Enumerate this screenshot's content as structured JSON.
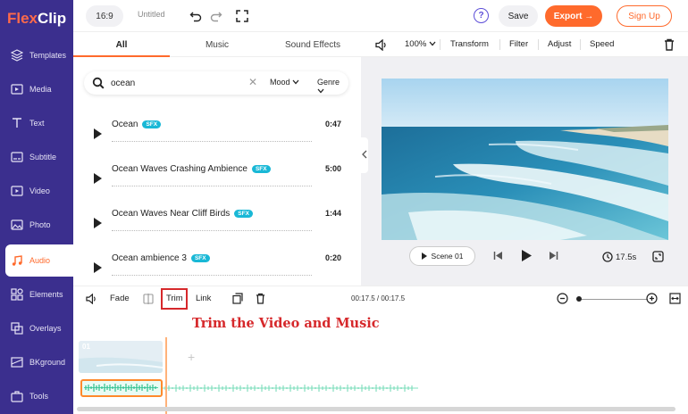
{
  "brand": {
    "name_part1": "Flex",
    "name_part2": "Clip"
  },
  "sidebar": {
    "items": [
      {
        "label": "Templates",
        "icon": "layers-icon"
      },
      {
        "label": "Media",
        "icon": "media-icon"
      },
      {
        "label": "Text",
        "icon": "text-icon"
      },
      {
        "label": "Subtitle",
        "icon": "subtitle-icon"
      },
      {
        "label": "Video",
        "icon": "video-icon"
      },
      {
        "label": "Photo",
        "icon": "photo-icon"
      },
      {
        "label": "Audio",
        "icon": "music-icon",
        "active": true
      },
      {
        "label": "Elements",
        "icon": "elements-icon"
      },
      {
        "label": "Overlays",
        "icon": "overlays-icon"
      },
      {
        "label": "BKground",
        "icon": "background-icon"
      },
      {
        "label": "Tools",
        "icon": "tools-icon"
      }
    ]
  },
  "topbar": {
    "ratio": "16:9",
    "doc_title": "Untitled",
    "help": "?",
    "save": "Save",
    "export": "Export →",
    "signup": "Sign Up"
  },
  "panel": {
    "tabs": [
      "All",
      "Music",
      "Sound Effects"
    ],
    "search": {
      "value": "ocean",
      "clear": "✕",
      "mood": "Mood",
      "genre": "Genre"
    },
    "tracks": [
      {
        "name": "Ocean",
        "badge": "SFX",
        "duration": "0:47"
      },
      {
        "name": "Ocean Waves Crashing Ambience",
        "badge": "SFX",
        "duration": "5:00"
      },
      {
        "name": "Ocean Waves Near Cliff Birds",
        "badge": "SFX",
        "duration": "1:44"
      },
      {
        "name": "Ocean ambience 3",
        "badge": "SFX",
        "duration": "0:20"
      }
    ]
  },
  "preview": {
    "toolbar": {
      "zoom": "100%",
      "transform": "Transform",
      "filter": "Filter",
      "adjust": "Adjust",
      "speed": "Speed"
    },
    "scene_label": "Scene 01",
    "duration": "17.5s"
  },
  "timeline": {
    "fade": "Fade",
    "trim": "Trim",
    "link": "Link",
    "timecode": "00:17.5 / 00:17.5",
    "annotation": "Trim the Video and Music",
    "clip_number": "01",
    "add": "+"
  },
  "colors": {
    "sidebar": "#3b2f8e",
    "accent": "#ff6a2c",
    "annotation": "#d6282b",
    "sfx_badge": "#19b8d6"
  }
}
